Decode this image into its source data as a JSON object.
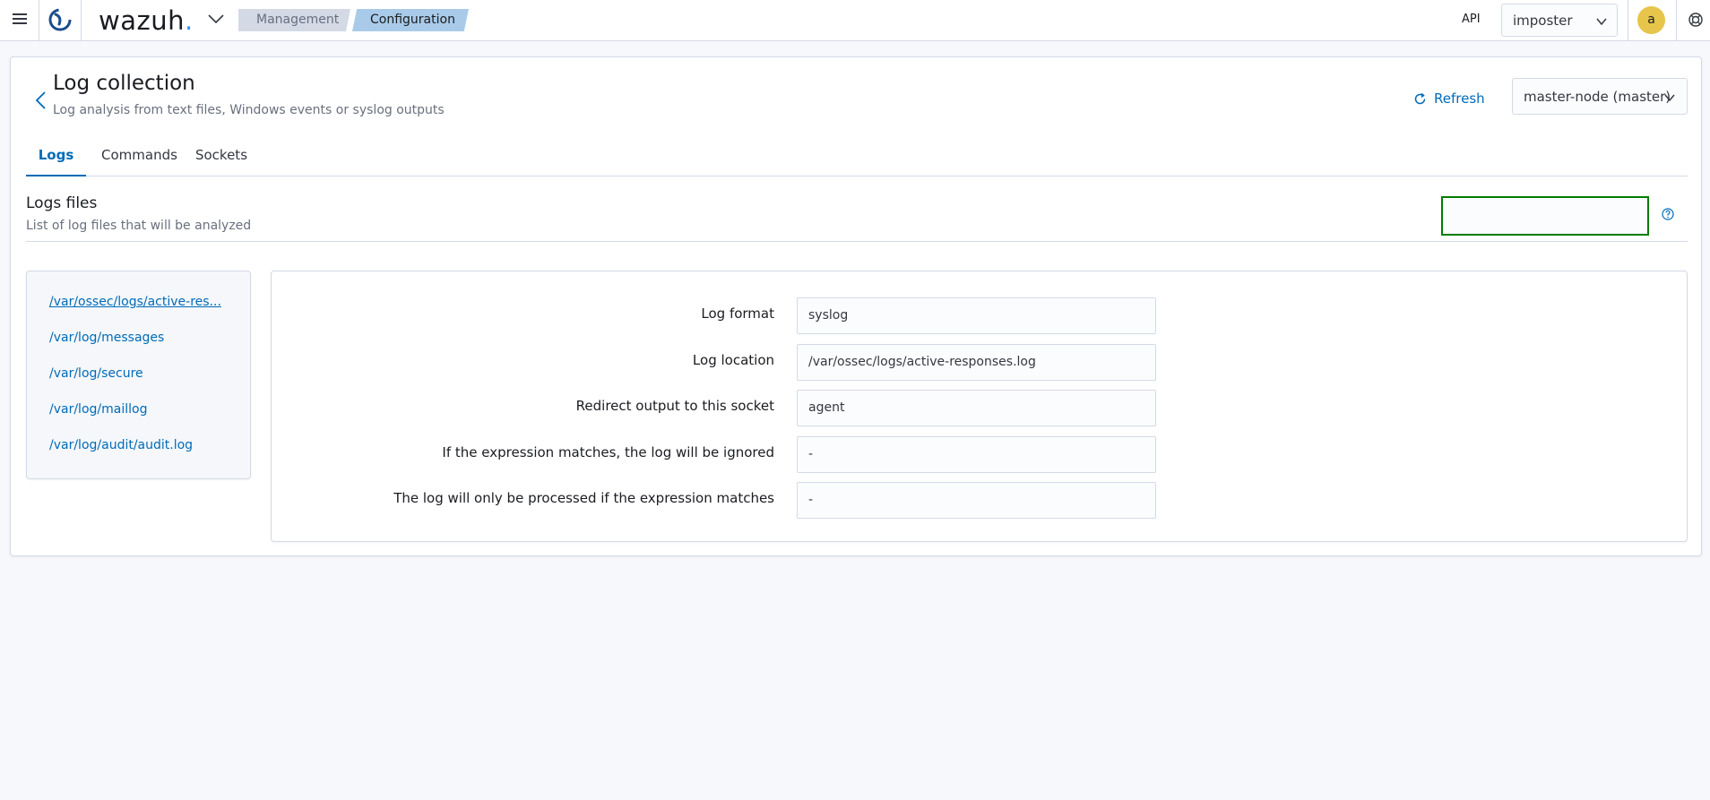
{
  "header": {
    "brand": "wazuh",
    "breadcrumbs": [
      "Management",
      "Configuration"
    ],
    "api_label": "API",
    "api_value": "imposter",
    "avatar_initial": "a"
  },
  "page": {
    "title": "Log collection",
    "subtitle": "Log analysis from text files, Windows events or syslog outputs",
    "refresh_label": "Refresh",
    "node_value": "master-node (master)"
  },
  "tabs": [
    {
      "label": "Logs",
      "active": true
    },
    {
      "label": "Commands",
      "active": false
    },
    {
      "label": "Sockets",
      "active": false
    }
  ],
  "section": {
    "title": "Logs files",
    "subtitle": "List of log files that will be analyzed",
    "search_value": ""
  },
  "files": [
    "/var/ossec/logs/active-res...",
    "/var/log/messages",
    "/var/log/secure",
    "/var/log/maillog",
    "/var/log/audit/audit.log"
  ],
  "details": [
    {
      "label": "Log format",
      "value": "syslog"
    },
    {
      "label": "Log location",
      "value": "/var/ossec/logs/active-responses.log"
    },
    {
      "label": "Redirect output to this socket",
      "value": "agent"
    },
    {
      "label": "If the expression matches, the log will be ignored",
      "value": "-"
    },
    {
      "label": "The log will only be processed if the expression matches",
      "value": "-"
    }
  ],
  "colors": {
    "accent": "#006bb8",
    "brand_dot": "#3595f9",
    "search_border": "#017d00",
    "avatar_bg": "#e7c44a"
  }
}
